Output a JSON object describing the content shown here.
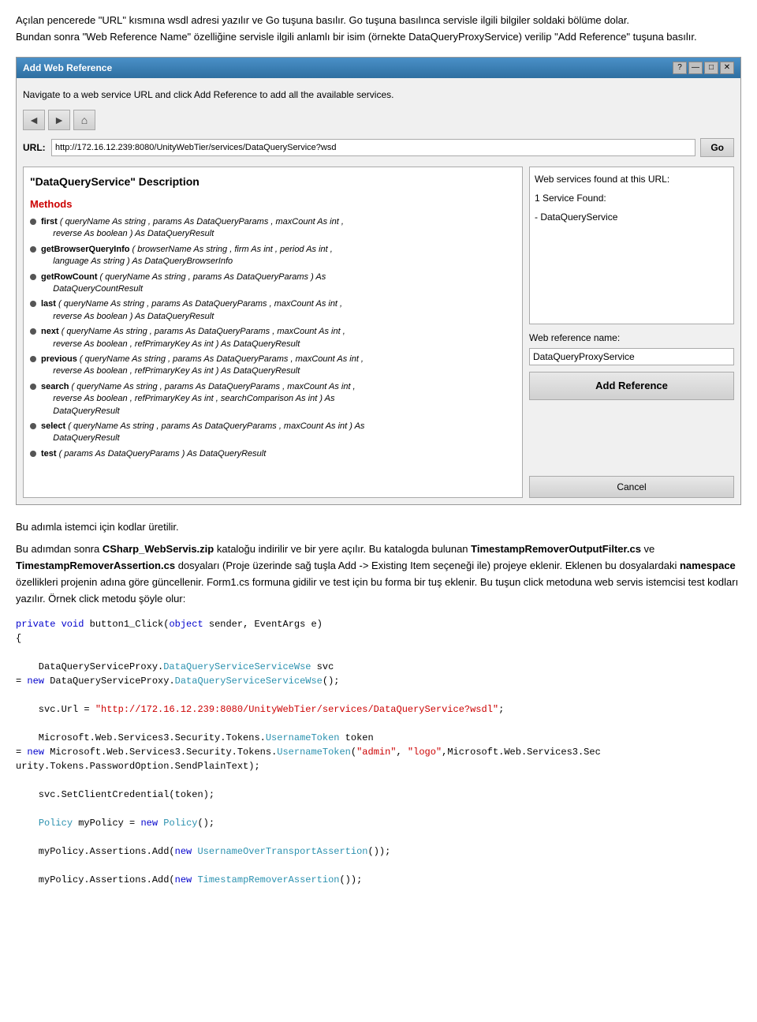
{
  "intro": {
    "para1": "Açılan pencerede \"URL\" kısmına wsdl adresi yazılır ve Go tuşuna basılır. Go tuşuna basılınca servisle ilgili bilgiler soldaki bölüme dolar.",
    "para2": "Bundan sonra \"Web Reference Name\" özelliğine servisle ilgili anlamlı bir isim (örnekte DataQueryProxyService) verilip \"Add Reference\" tuşuna basılır."
  },
  "dialog": {
    "title": "Add Web Reference",
    "hint": "Navigate to a web service URL and click Add Reference to add all the available services.",
    "url_label": "URL:",
    "url_value": "http://172.16.12.239:8080/UnityWebTier/services/DataQueryService?wsd",
    "go_label": "Go",
    "back_label": "◄ Back",
    "forward_label": "►",
    "home_label": "⌂",
    "service_title": "\"DataQueryService\" Description",
    "methods_label": "Methods",
    "methods": [
      {
        "name": "first",
        "params": "( queryName As string , params As DataQueryParams , maxCount As int , reverse As boolean ) As DataQueryResult"
      },
      {
        "name": "getBrowserQueryInfo",
        "params": "( browserName As string , firm As int , period As int , language As string ) As DataQueryBrowserInfo"
      },
      {
        "name": "getRowCount",
        "params": "( queryName As string , params As DataQueryParams ) As DataQueryCountResult"
      },
      {
        "name": "last",
        "params": "( queryName As string , params As DataQueryParams , maxCount As int , reverse As boolean ) As DataQueryResult"
      },
      {
        "name": "next",
        "params": "( queryName As string , params As DataQueryParams , maxCount As int , reverse As boolean , refPrimaryKey As int ) As DataQueryResult"
      },
      {
        "name": "previous",
        "params": "( queryName As string , params As DataQueryParams , maxCount As int , reverse As boolean , refPrimaryKey As int ) As DataQueryResult"
      },
      {
        "name": "search",
        "params": "( queryName As string , params As DataQueryParams , maxCount As int , reverse As boolean , refPrimaryKey As int , searchComparison As int ) As DataQueryResult"
      },
      {
        "name": "select",
        "params": "( queryName As string , params As DataQueryParams , maxCount As int ) As DataQueryResult"
      },
      {
        "name": "test",
        "params": "( params As DataQueryParams ) As DataQueryResult"
      }
    ],
    "web_services_title": "Web services found at this URL:",
    "services_found": "1 Service Found:",
    "service_name": "- DataQueryService",
    "ref_name_label": "Web reference name:",
    "ref_name_value": "DataQueryProxyService",
    "add_reference_label": "Add Reference",
    "cancel_label": "Cancel"
  },
  "article": {
    "para1": "Bu adımla istemci için kodlar üretilir.",
    "para2_pre": "Bu adımdan sonra ",
    "para2_bold": "CSharp_WebServis.zip",
    "para2_post": " kataloğu indirilir ve bir yere açılır. Bu katalogda bulunan ",
    "para2_bold2": "TimestampRemoverOutputFilter.cs",
    "para2_and": " ve ",
    "para2_bold3": "TimestampRemoverAssertion.cs",
    "para2_end": " dosyaları (Proje üzerinde sağ tuşla Add -> Existing Item seçeneği ile) projeye eklenir. Eklenen bu dosyalardaki ",
    "para2_bold4": "namespace",
    "para2_end2": " özellikleri projenin adına göre güncellenir. Form1.cs formuna gidilir ve test için bu forma bir tuş eklenir. Bu tuşun click metoduna web servis istemcisi test kodları yazılır. Örnek click metodu şöyle olur:"
  },
  "code": {
    "lines": [
      {
        "text": "private void button1_Click(object sender, EventArgs e)",
        "type": "mixed",
        "parts": [
          {
            "t": "private ",
            "c": "keyword"
          },
          {
            "t": "void",
            "c": "keyword"
          },
          {
            "t": " button1_Click(",
            "c": "normal"
          },
          {
            "t": "object",
            "c": "keyword"
          },
          {
            "t": " sender, EventArgs e)",
            "c": "normal"
          }
        ]
      },
      {
        "text": "{",
        "type": "normal"
      },
      {
        "text": "",
        "type": "normal"
      },
      {
        "text": "    DataQueryServiceProxy.DataQueryServiceServiceWse svc",
        "indent": 1,
        "parts": [
          {
            "t": "    DataQueryServiceProxy.",
            "c": "normal"
          },
          {
            "t": "DataQueryServiceServiceWse",
            "c": "type"
          },
          {
            "t": " svc",
            "c": "normal"
          }
        ]
      },
      {
        "text": "= new DataQueryServiceProxy.DataQueryServiceServiceWse();",
        "parts": [
          {
            "t": "= ",
            "c": "keyword"
          },
          {
            "t": "new",
            "c": "keyword"
          },
          {
            "t": " DataQueryServiceProxy.",
            "c": "normal"
          },
          {
            "t": "DataQueryServiceServiceWse",
            "c": "type"
          },
          {
            "t": "();",
            "c": "normal"
          }
        ]
      },
      {
        "text": "",
        "type": "normal"
      },
      {
        "text": "    svc.Url = \"http://172.16.12.239:8080/UnityWebTier/services/DataQueryService?wsdl&quot;;",
        "indent": 1,
        "parts": [
          {
            "t": "    svc.Url = ",
            "c": "normal"
          },
          {
            "t": "\"http://172.16.12.239:8080/UnityWebTier/services/DataQueryService?wsdl&quot;",
            "c": "string"
          },
          {
            "t": ";",
            "c": "normal"
          }
        ]
      },
      {
        "text": "",
        "type": "normal"
      },
      {
        "text": "    Microsoft.Web.Services3.Security.Tokens.UsernameToken token",
        "indent": 1,
        "parts": [
          {
            "t": "    Microsoft.Web.Services3.Security.Tokens.",
            "c": "normal"
          },
          {
            "t": "UsernameToken",
            "c": "type"
          },
          {
            "t": " token",
            "c": "normal"
          }
        ]
      },
      {
        "text": "= new Microsoft.Web.Services3.Security.Tokens.UsernameToken(\"admin\", \"logo\",Microsoft.Web.Services3.Sec",
        "parts": [
          {
            "t": "= ",
            "c": "keyword"
          },
          {
            "t": "new",
            "c": "keyword"
          },
          {
            "t": " Microsoft.Web.Services3.Security.Tokens.",
            "c": "normal"
          },
          {
            "t": "UsernameToken",
            "c": "type"
          },
          {
            "t": "(",
            "c": "normal"
          },
          {
            "t": "\"admin\"",
            "c": "string"
          },
          {
            "t": ", ",
            "c": "normal"
          },
          {
            "t": "\"logo\"",
            "c": "string"
          },
          {
            "t": ",Microsoft.Web.Services3.Sec",
            "c": "normal"
          }
        ]
      },
      {
        "text": "urity.Tokens.PasswordOption.SendPlainText);",
        "parts": [
          {
            "t": "urity.Tokens.PasswordOption.SendPlainText);",
            "c": "normal"
          }
        ]
      },
      {
        "text": "",
        "type": "normal"
      },
      {
        "text": "    svc.SetClientCredential(token);",
        "indent": 1,
        "parts": [
          {
            "t": "    svc.SetClientCredential(token);",
            "c": "normal"
          }
        ]
      },
      {
        "text": "",
        "type": "normal"
      },
      {
        "text": "    Policy myPolicy = new Policy();",
        "indent": 1,
        "parts": [
          {
            "t": "    ",
            "c": "normal"
          },
          {
            "t": "Policy",
            "c": "type"
          },
          {
            "t": " myPolicy = ",
            "c": "normal"
          },
          {
            "t": "new",
            "c": "keyword"
          },
          {
            "t": " ",
            "c": "normal"
          },
          {
            "t": "Policy",
            "c": "type"
          },
          {
            "t": "();",
            "c": "normal"
          }
        ]
      },
      {
        "text": "",
        "type": "normal"
      },
      {
        "text": "    myPolicy.Assertions.Add(new UsernameOverTransportAssertion());",
        "indent": 1,
        "parts": [
          {
            "t": "    myPolicy.Assertions.Add(",
            "c": "normal"
          },
          {
            "t": "new",
            "c": "keyword"
          },
          {
            "t": " ",
            "c": "normal"
          },
          {
            "t": "UsernameOverTransportAssertion",
            "c": "type"
          },
          {
            "t": "());",
            "c": "normal"
          }
        ]
      },
      {
        "text": "",
        "type": "normal"
      },
      {
        "text": "    myPolicy.Assertions.Add(new TimestampRemoverAssertion());",
        "indent": 1,
        "parts": [
          {
            "t": "    myPolicy.Assertions.Add(",
            "c": "normal"
          },
          {
            "t": "new",
            "c": "keyword"
          },
          {
            "t": " ",
            "c": "normal"
          },
          {
            "t": "TimestampRemoverAssertion",
            "c": "type"
          },
          {
            "t": "());",
            "c": "normal"
          }
        ]
      }
    ]
  },
  "icons": {
    "back": "◄",
    "forward": "►",
    "home": "⌂",
    "close": "✕",
    "maximize": "□",
    "minimize": "—",
    "help": "?"
  }
}
